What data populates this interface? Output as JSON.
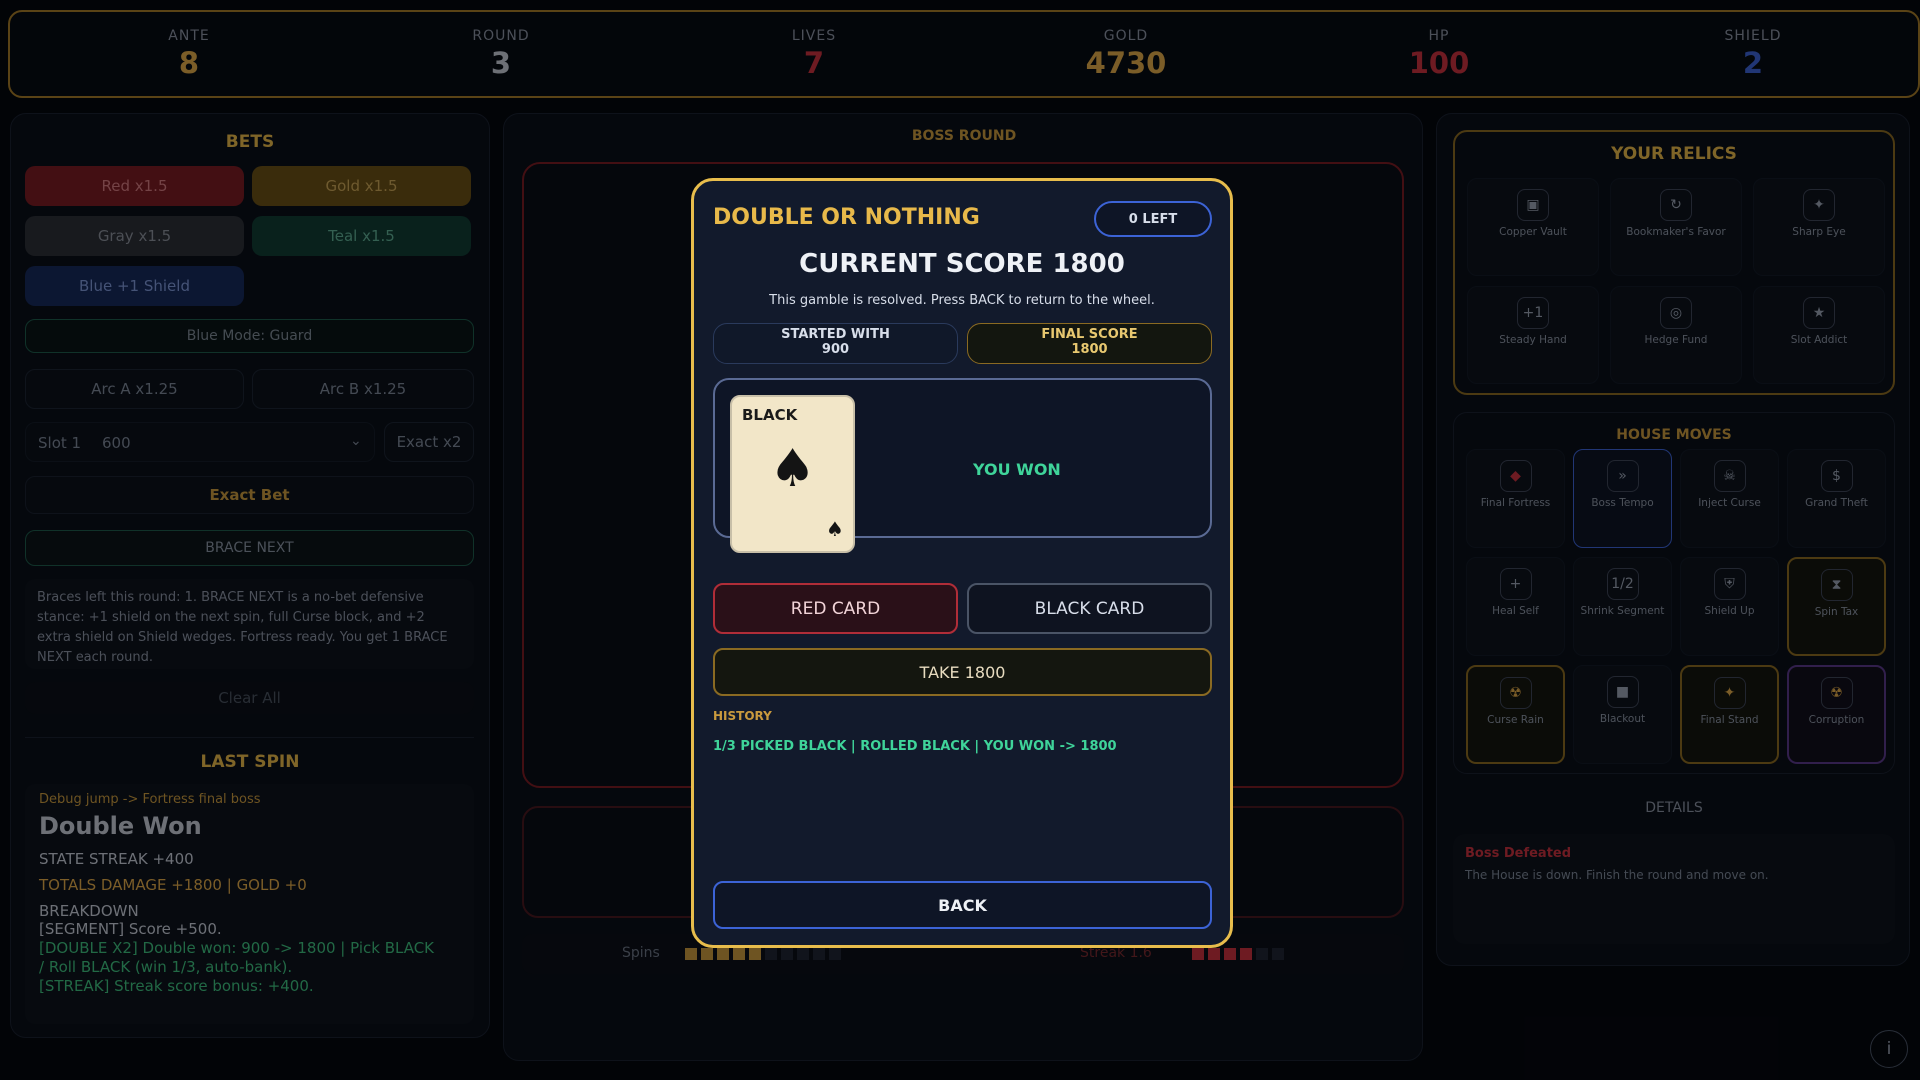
{
  "stats": {
    "ante": {
      "label": "ANTE",
      "value": "8"
    },
    "round": {
      "label": "ROUND",
      "value": "3"
    },
    "lives": {
      "label": "LIVES",
      "value": "7"
    },
    "gold": {
      "label": "GOLD",
      "value": "4730"
    },
    "hp": {
      "label": "HP",
      "value": "100"
    },
    "shield": {
      "label": "SHIELD",
      "value": "2"
    }
  },
  "bets": {
    "title": "BETS",
    "red": "Red x1.5",
    "gold": "Gold x1.5",
    "gray": "Gray x1.5",
    "teal": "Teal x1.5",
    "blue": "Blue +1 Shield",
    "blue_mode": "Blue Mode: Guard",
    "arc_a": "Arc A x1.25",
    "arc_b": "Arc B x1.25",
    "slot_label": "Slot 1",
    "slot_value": "600",
    "exact_x2": "Exact x2",
    "exact_bet": "Exact Bet",
    "brace_next": "BRACE NEXT",
    "brace_info": "Braces left this round: 1. BRACE NEXT is a no-bet defensive stance: +1 shield on the next spin, full Curse block, and +2 extra shield on Shield wedges. Fortress ready. You get 1 BRACE NEXT each round.",
    "clear_all": "Clear All"
  },
  "last_spin": {
    "title": "LAST SPIN",
    "debug": "Debug jump -> Fortress final boss",
    "headline": "Double Won",
    "state": "STATE  STREAK +400",
    "totals": "TOTALS  DAMAGE +1800 | GOLD +0",
    "breakdown_label": "BREAKDOWN",
    "line1": "[SEGMENT] Score +500.",
    "line2": "[DOUBLE X2] Double won: 900 -> 1800 | Pick BLACK / Roll BLACK (win 1/3, auto-bank).",
    "line3": "[STREAK] Streak score bonus: +400."
  },
  "center": {
    "boss_round": "BOSS ROUND",
    "spins_label": "Spins",
    "streak_label": "Streak 1.6"
  },
  "relics": {
    "title": "YOUR RELICS",
    "items": [
      {
        "name": "Copper Vault",
        "icon": "▣"
      },
      {
        "name": "Bookmaker's Favor",
        "icon": "↻"
      },
      {
        "name": "Sharp Eye",
        "icon": "✦"
      },
      {
        "name": "Steady Hand",
        "icon": "+1"
      },
      {
        "name": "Hedge Fund",
        "icon": "◎"
      },
      {
        "name": "Slot Addict",
        "icon": "★"
      }
    ]
  },
  "moves": {
    "title": "HOUSE MOVES",
    "items": [
      {
        "name": "Final Fortress",
        "icon": "◆"
      },
      {
        "name": "Boss Tempo",
        "icon": "»"
      },
      {
        "name": "Inject Curse",
        "icon": "☠"
      },
      {
        "name": "Grand Theft",
        "icon": "$"
      },
      {
        "name": "Heal Self",
        "icon": "+"
      },
      {
        "name": "Shrink Segment",
        "icon": "1/2"
      },
      {
        "name": "Shield Up",
        "icon": "⛨"
      },
      {
        "name": "Spin Tax",
        "icon": "⧗"
      },
      {
        "name": "Curse Rain",
        "icon": "☢"
      },
      {
        "name": "Blackout",
        "icon": "■"
      },
      {
        "name": "Final Stand",
        "icon": "✦"
      },
      {
        "name": "Corruption",
        "icon": "☢"
      }
    ]
  },
  "details": {
    "title": "DETAILS",
    "status": "Boss Defeated",
    "text": "The House is down. Finish the round and move on."
  },
  "modal": {
    "title": "DOUBLE OR NOTHING",
    "left_badge": "0 LEFT",
    "score": "CURRENT SCORE 1800",
    "resolved": "This gamble is resolved. Press BACK to return to the wheel.",
    "started_label": "STARTED WITH",
    "started_value": "900",
    "final_label": "FINAL SCORE",
    "final_value": "1800",
    "card_color": "BLACK",
    "card_suit": "♠",
    "result": "YOU WON",
    "red_card": "RED CARD",
    "black_card": "BLACK CARD",
    "take": "TAKE 1800",
    "history_label": "HISTORY",
    "history_line": "1/3 PICKED BLACK | ROLLED BLACK | YOU WON -> 1800",
    "back": "BACK"
  },
  "info_button": "i",
  "colors": {
    "gold": "#e8b94a",
    "red": "#c8323f",
    "blue": "#3c63d6",
    "green": "#3fd49a"
  }
}
